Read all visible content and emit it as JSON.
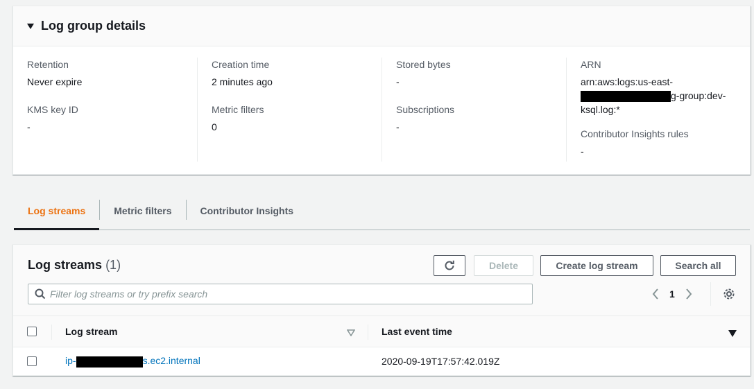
{
  "details": {
    "title": "Log group details",
    "retention_label": "Retention",
    "retention_value": "Never expire",
    "kms_label": "KMS key ID",
    "kms_value": "-",
    "creation_label": "Creation time",
    "creation_value": "2 minutes ago",
    "metric_filters_label": "Metric filters",
    "metric_filters_value": "0",
    "stored_bytes_label": "Stored bytes",
    "stored_bytes_value": "-",
    "subscriptions_label": "Subscriptions",
    "subscriptions_value": "-",
    "arn_label": "ARN",
    "arn_prefix": "arn:aws:logs:us-east-",
    "arn_suffix_1": "g-group:dev-",
    "arn_suffix_2": "ksql.log:*",
    "contributor_label": "Contributor Insights rules",
    "contributor_value": "-"
  },
  "tabs": [
    {
      "label": "Log streams",
      "active": true
    },
    {
      "label": "Metric filters",
      "active": false
    },
    {
      "label": "Contributor Insights",
      "active": false
    }
  ],
  "streams": {
    "title": "Log streams",
    "count": "(1)",
    "delete_label": "Delete",
    "create_label": "Create log stream",
    "search_all_label": "Search all",
    "search_placeholder": "Filter log streams or try prefix search",
    "page": "1",
    "col_stream": "Log stream",
    "col_last_event": "Last event time",
    "rows": [
      {
        "stream_prefix": "ip-",
        "stream_suffix": "s.ec2.internal",
        "last_event": "2020-09-19T17:57:42.019Z"
      }
    ]
  },
  "colors": {
    "accent": "#ec7211",
    "link": "#0073bb"
  }
}
